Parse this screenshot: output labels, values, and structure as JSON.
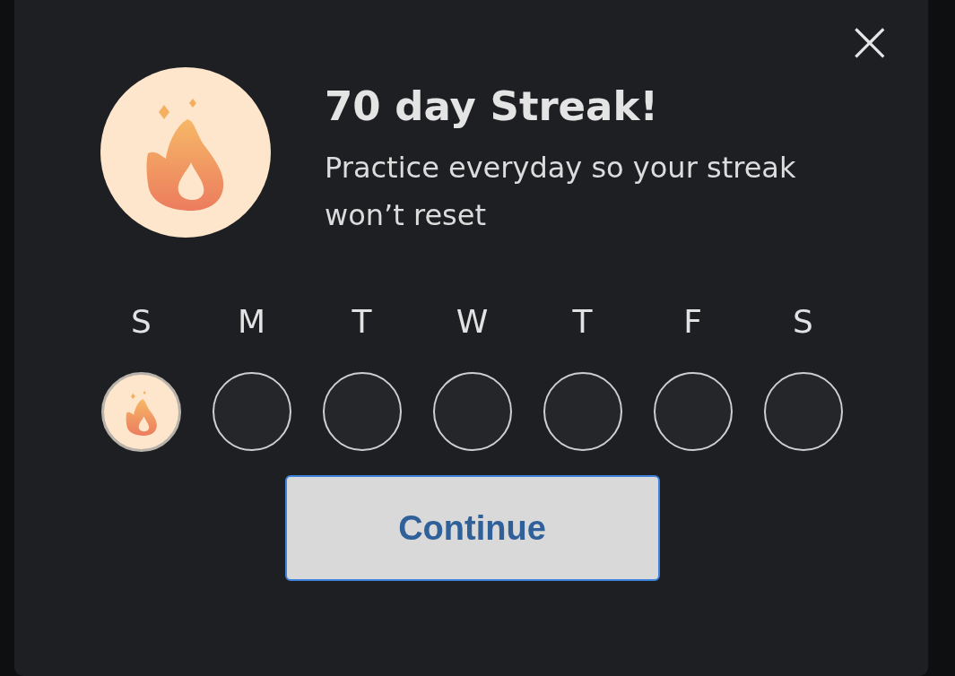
{
  "dialog": {
    "close": "×",
    "title": "70 day Streak!",
    "message": "Practice everyday so your streak won’t reset"
  },
  "days": [
    {
      "label": "S",
      "done": true
    },
    {
      "label": "M",
      "done": false
    },
    {
      "label": "T",
      "done": false
    },
    {
      "label": "W",
      "done": false
    },
    {
      "label": "T",
      "done": false
    },
    {
      "label": "F",
      "done": false
    },
    {
      "label": "S",
      "done": false
    }
  ],
  "button": "Continue"
}
